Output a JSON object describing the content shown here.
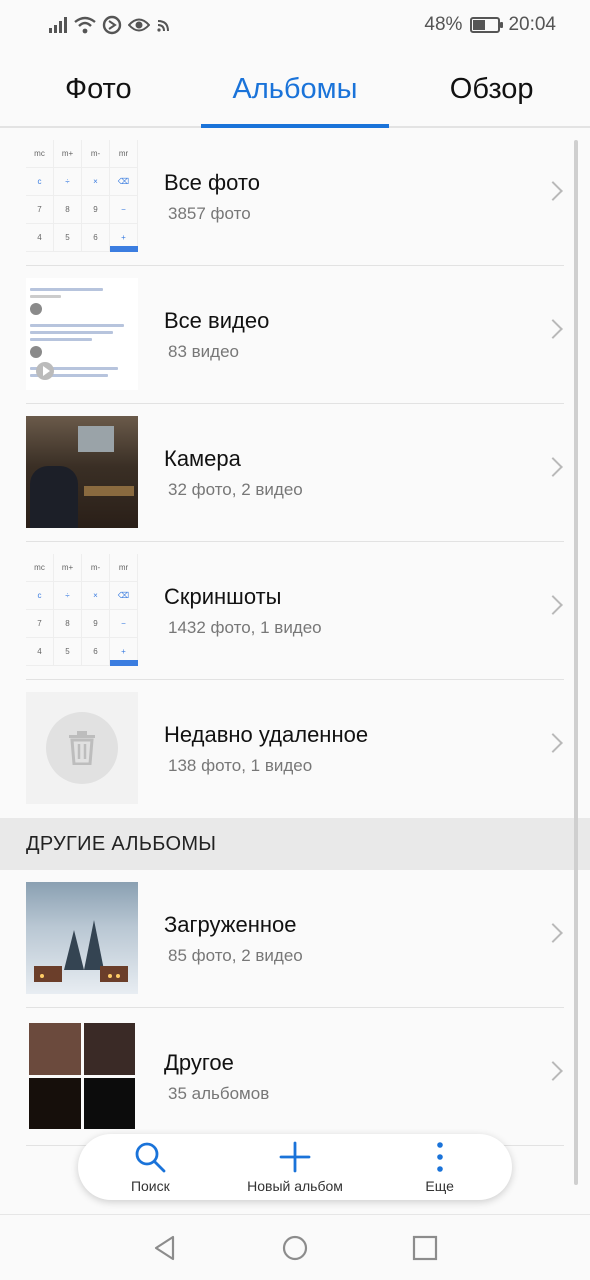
{
  "status_bar": {
    "battery_percent": "48%",
    "battery_level": 0.48,
    "time": "20:04"
  },
  "tabs": [
    {
      "label": "Фото",
      "active": false
    },
    {
      "label": "Альбомы",
      "active": true
    },
    {
      "label": "Обзор",
      "active": false
    }
  ],
  "albums": [
    {
      "name": "Все фото",
      "count": "3857 фото",
      "thumb": "calculator-screenshot"
    },
    {
      "name": "Все видео",
      "count": "83 видео",
      "thumb": "video-feed"
    },
    {
      "name": "Камера",
      "count": "32 фото,  2 видео",
      "thumb": "camera-photo"
    },
    {
      "name": "Скриншоты",
      "count": "1432 фото,  1 видео",
      "thumb": "calculator-screenshot"
    },
    {
      "name": "Недавно удаленное",
      "count": "138 фото,  1 видео",
      "thumb": "trash-icon"
    }
  ],
  "other_section": {
    "title": "ДРУГИЕ АЛЬБОМЫ",
    "albums": [
      {
        "name": "Загруженное",
        "count": "85 фото,  2 видео",
        "thumb": "winter-village"
      },
      {
        "name": "Другое",
        "count": "35 альбомов",
        "thumb": "photo-grid"
      }
    ]
  },
  "calculator": {
    "rows": [
      [
        "mc",
        "m+",
        "m-",
        "mr"
      ],
      [
        "c",
        "÷",
        "×",
        "⌫"
      ],
      [
        "7",
        "8",
        "9",
        "−"
      ],
      [
        "4",
        "5",
        "6",
        "+"
      ]
    ]
  },
  "toolbar": {
    "search_label": "Поиск",
    "new_album_label": "Новый альбом",
    "more_label": "Еще"
  },
  "colors": {
    "accent": "#1a73d9",
    "text_primary": "#111111",
    "text_secondary": "#777777"
  }
}
